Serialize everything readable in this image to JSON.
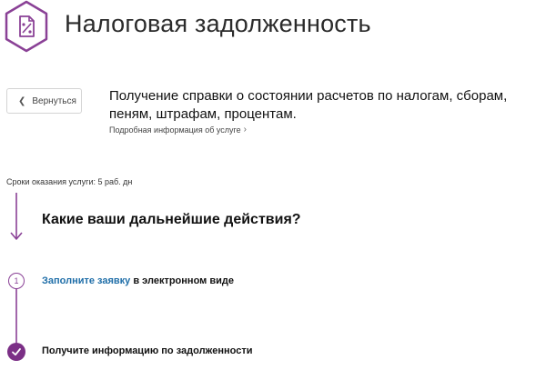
{
  "header": {
    "title": "Налоговая задолженность",
    "icon": "tax-document-percent-icon",
    "accent_color": "#8a4196"
  },
  "back_button": {
    "label": "Вернуться",
    "icon": "chevron-left-icon"
  },
  "service": {
    "title": "Получение справки о состоянии расчетов по налогам, сборам, пеням, штрафам, процентам.",
    "details_link": "Подробная информация об услуге",
    "details_icon": "chevron-right-icon"
  },
  "duration_text": "Сроки оказания услуги: 5 раб. дн",
  "question": "Какие ваши дальнейшие действия?",
  "steps": [
    {
      "number": "1",
      "link_text": "Заполните заявку",
      "rest_text": " в электронном виде"
    },
    {
      "text": "Получите информацию по задолженности",
      "icon": "check-icon"
    }
  ]
}
